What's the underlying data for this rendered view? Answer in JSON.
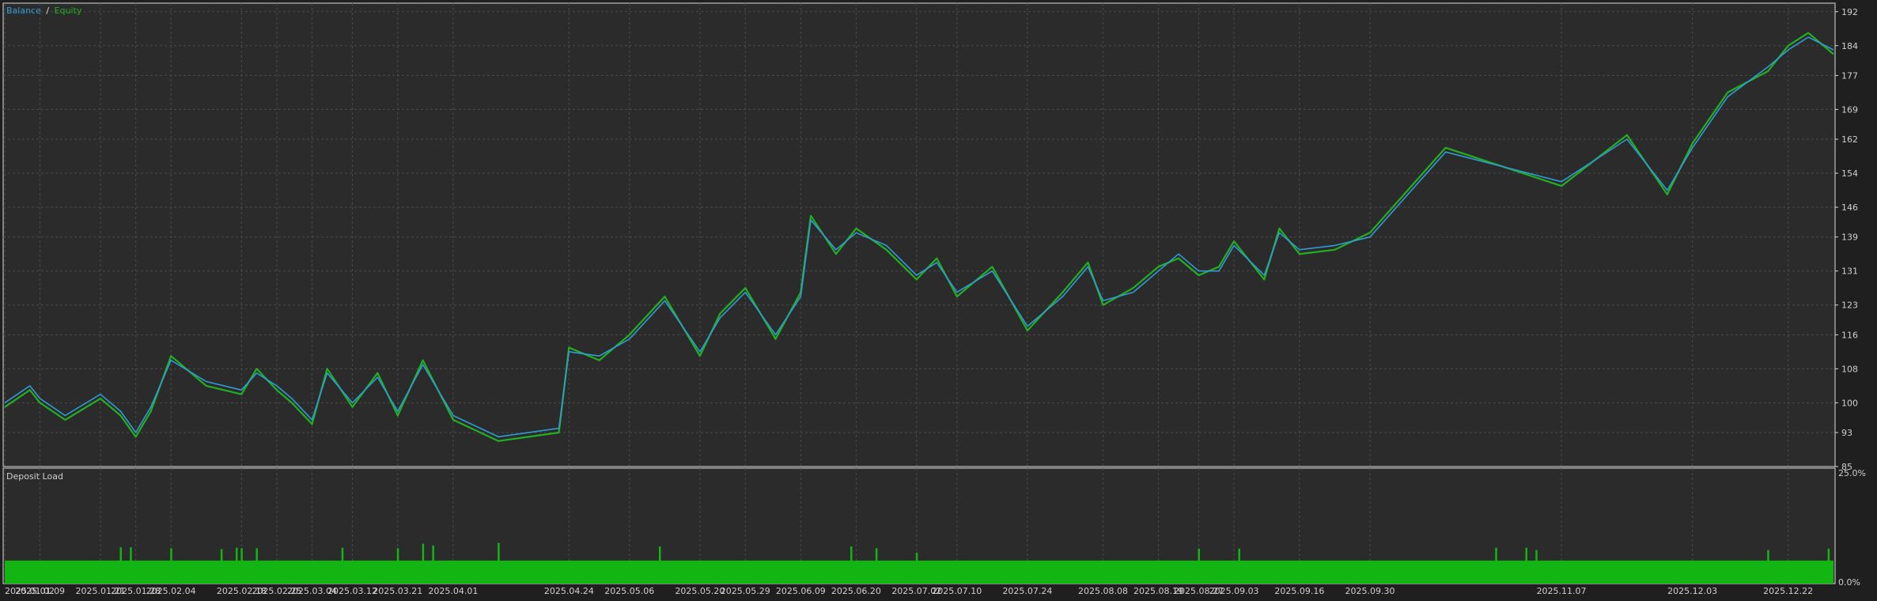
{
  "legend": {
    "balance": "Balance",
    "separator": "/",
    "equity": "Equity"
  },
  "deposit_label": "Deposit Load",
  "colors": {
    "background": "#2b2b2b",
    "grid": "#4a4a4a",
    "axis_text": "#cfcfcf",
    "balance": "#2f9bd6",
    "equity": "#22b022",
    "deposit": "#13b513"
  },
  "chart_data": [
    {
      "type": "line",
      "title": "",
      "series": [
        {
          "name": "Balance",
          "color": "#2f9bd6"
        },
        {
          "name": "Equity",
          "color": "#22b022"
        }
      ],
      "y_ticks": [
        192,
        184,
        177,
        169,
        162,
        154,
        146,
        139,
        131,
        123,
        116,
        108,
        100,
        93,
        85
      ],
      "ylim": [
        85,
        194
      ],
      "x_ticks": [
        "2025.01.02",
        "2025.01.09",
        "2025.01.21",
        "2025.01.28",
        "2025.02.04",
        "2025.02.18",
        "2025.02.25",
        "2025.03.04",
        "2025.03.12",
        "2025.03.21",
        "2025.04.01",
        "2025.04.24",
        "2025.05.06",
        "2025.05.20",
        "2025.05.29",
        "2025.06.09",
        "2025.06.20",
        "2025.07.02",
        "2025.07.10",
        "2025.07.24",
        "2025.08.08",
        "2025.08.19",
        "2025.08.27",
        "2025.09.03",
        "2025.09.16",
        "2025.09.30",
        "2025.11.07",
        "2025.12.03",
        "2025.12.22"
      ],
      "x": [
        "2025.01.02",
        "2025.01.07",
        "2025.01.09",
        "2025.01.14",
        "2025.01.21",
        "2025.01.25",
        "2025.01.28",
        "2025.01.31",
        "2025.02.04",
        "2025.02.11",
        "2025.02.18",
        "2025.02.21",
        "2025.02.25",
        "2025.02.28",
        "2025.03.04",
        "2025.03.07",
        "2025.03.12",
        "2025.03.17",
        "2025.03.21",
        "2025.03.26",
        "2025.04.01",
        "2025.04.10",
        "2025.04.22",
        "2025.04.24",
        "2025.04.30",
        "2025.05.06",
        "2025.05.13",
        "2025.05.20",
        "2025.05.24",
        "2025.05.29",
        "2025.06.04",
        "2025.06.09",
        "2025.06.11",
        "2025.06.16",
        "2025.06.20",
        "2025.06.26",
        "2025.07.02",
        "2025.07.06",
        "2025.07.10",
        "2025.07.17",
        "2025.07.24",
        "2025.07.31",
        "2025.08.05",
        "2025.08.08",
        "2025.08.14",
        "2025.08.19",
        "2025.08.23",
        "2025.08.27",
        "2025.08.31",
        "2025.09.03",
        "2025.09.09",
        "2025.09.12",
        "2025.09.16",
        "2025.09.23",
        "2025.09.30",
        "2025.10.15",
        "2025.11.07",
        "2025.11.20",
        "2025.11.28",
        "2025.12.03",
        "2025.12.10",
        "2025.12.18",
        "2025.12.22",
        "2025.12.26",
        "2025.12.31"
      ],
      "balance": [
        100,
        104,
        101,
        97,
        102,
        98,
        93,
        99,
        110,
        105,
        103,
        107,
        104,
        101,
        96,
        107,
        100,
        106,
        98,
        109,
        97,
        92,
        94,
        112,
        111,
        115,
        124,
        112,
        120,
        126,
        116,
        125,
        143,
        136,
        140,
        137,
        130,
        133,
        126,
        131,
        118,
        125,
        132,
        124,
        126,
        131,
        135,
        131,
        131,
        137,
        130,
        140,
        136,
        137,
        139,
        159,
        152,
        162,
        150,
        160,
        172,
        179,
        183,
        186,
        183
      ],
      "equity": [
        99,
        103,
        100,
        96,
        101,
        97,
        92,
        98,
        111,
        104,
        102,
        108,
        103,
        100,
        95,
        108,
        99,
        107,
        97,
        110,
        96,
        91,
        93,
        113,
        110,
        116,
        125,
        111,
        121,
        127,
        115,
        126,
        144,
        135,
        141,
        136,
        129,
        134,
        125,
        132,
        117,
        126,
        133,
        123,
        127,
        132,
        134,
        130,
        132,
        138,
        129,
        141,
        135,
        136,
        140,
        160,
        151,
        163,
        149,
        161,
        173,
        178,
        184,
        187,
        182
      ]
    },
    {
      "type": "bar",
      "title": "Deposit Load",
      "y_ticks": [
        "25.0%",
        "0.0%"
      ],
      "ylim": [
        0,
        25
      ],
      "base_level": 5.2,
      "spikes": [
        {
          "x": "2025.01.25",
          "value": 8.2
        },
        {
          "x": "2025.01.27",
          "value": 8.2
        },
        {
          "x": "2025.02.04",
          "value": 8.0
        },
        {
          "x": "2025.02.14",
          "value": 7.8
        },
        {
          "x": "2025.02.17",
          "value": 8.1
        },
        {
          "x": "2025.02.18",
          "value": 8.0
        },
        {
          "x": "2025.02.21",
          "value": 8.0
        },
        {
          "x": "2025.03.10",
          "value": 8.1
        },
        {
          "x": "2025.03.21",
          "value": 8.0
        },
        {
          "x": "2025.03.26",
          "value": 9.0
        },
        {
          "x": "2025.03.28",
          "value": 8.6
        },
        {
          "x": "2025.04.10",
          "value": 9.2
        },
        {
          "x": "2025.05.12",
          "value": 8.4
        },
        {
          "x": "2025.06.19",
          "value": 8.4
        },
        {
          "x": "2025.06.24",
          "value": 8.0
        },
        {
          "x": "2025.07.02",
          "value": 7.0
        },
        {
          "x": "2025.08.27",
          "value": 7.9
        },
        {
          "x": "2025.09.04",
          "value": 7.9
        },
        {
          "x": "2025.10.25",
          "value": 8.1
        },
        {
          "x": "2025.10.31",
          "value": 8.1
        },
        {
          "x": "2025.11.02",
          "value": 7.6
        },
        {
          "x": "2025.12.18",
          "value": 7.6
        },
        {
          "x": "2025.12.30",
          "value": 7.9
        }
      ]
    }
  ]
}
